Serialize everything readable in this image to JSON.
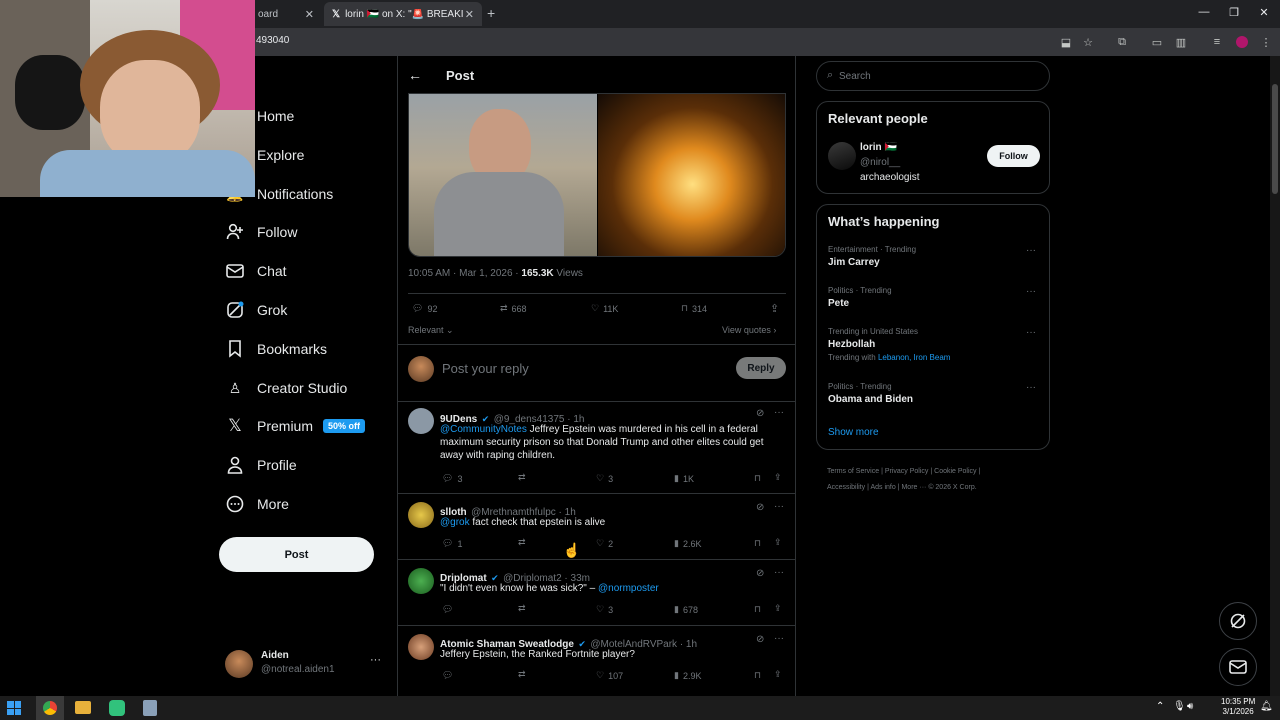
{
  "browser": {
    "tabs": [
      {
        "label": "oard"
      },
      {
        "label": "lorin 🇵🇸 on X: \"🚨 BREAKING: N"
      }
    ],
    "url": "493040"
  },
  "nav": {
    "items": [
      {
        "label": "Home"
      },
      {
        "label": "Explore"
      },
      {
        "label": "Notifications"
      },
      {
        "label": "Follow"
      },
      {
        "label": "Chat"
      },
      {
        "label": "Grok"
      },
      {
        "label": "Bookmarks"
      },
      {
        "label": "Creator Studio"
      },
      {
        "label": "Premium"
      },
      {
        "label": "Profile"
      },
      {
        "label": "More"
      }
    ],
    "premium_badge": "50% off",
    "post_button": "Post",
    "account": {
      "name": "Aiden",
      "handle": "@notreal.aiden1",
      "more": "···"
    }
  },
  "post": {
    "header_title": "Post",
    "timestamp": "10:05 AM · Mar 1, 2026 · ",
    "views_count": "165.3K",
    "views_label": " Views",
    "replies": "92",
    "reposts": "668",
    "likes": "11K",
    "bookmarks": "314",
    "sort": "Relevant",
    "view_quotes": "View quotes",
    "reply_placeholder": "Post your reply",
    "reply_button": "Reply"
  },
  "replies": [
    {
      "name": "9UDens",
      "handle": "@9_dens41375 · 1h",
      "mention": "@CommunityNotes",
      "text": " Jeffrey Epstein was murdered in his cell in a federal maximum security prison so that Donald Trump and other elites could get away with raping children.",
      "replies": "3",
      "reposts": "",
      "likes": "3",
      "views": "1K"
    },
    {
      "name": "slloth",
      "handle": "@Mrethnamthfulpc · 1h",
      "mention": "@grok",
      "text": " fact check that epstein is alive",
      "replies": "1",
      "reposts": "",
      "likes": "2",
      "views": "2.6K"
    },
    {
      "name": "Driplomat",
      "handle": "@Driplomat2 · 33m",
      "text": "\"I didn't even know he was sick?\" – ",
      "mention_after": "@normposter",
      "replies": "",
      "reposts": "",
      "likes": "3",
      "views": "678"
    },
    {
      "name": "Atomic Shaman Sweatlodge",
      "handle": "@MotelAndRVPark · 1h",
      "text": "Jeffery Epstein, the Ranked Fortnite player?",
      "replies": "",
      "reposts": "",
      "likes": "107",
      "views": "2.9K"
    }
  ],
  "sidebar": {
    "search_placeholder": "Search",
    "relevant_title": "Relevant people",
    "person": {
      "name": "lorin 🇵🇸",
      "handle": "@nirol__",
      "bio": "archaeologist",
      "follow": "Follow"
    },
    "happening_title": "What’s happening",
    "trends": [
      {
        "category": "Entertainment · Trending",
        "name": "Jim Carrey"
      },
      {
        "category": "Politics · Trending",
        "name": "Pete"
      },
      {
        "category": "Trending in United States",
        "name": "Hezbollah",
        "extra_prefix": "Trending with ",
        "extra_links": "Lebanon, Iron Beam"
      },
      {
        "category": "Politics · Trending",
        "name": "Obama and Biden"
      }
    ],
    "show_more": "Show more",
    "footer": [
      "Terms of Service",
      "Privacy Policy",
      "Cookie Policy",
      "Accessibility",
      "Ads info",
      "More ···",
      "© 2026 X Corp."
    ]
  },
  "taskbar": {
    "time": "10:35 PM",
    "date": "3/1/2026"
  },
  "colors": {
    "accent": "#1d9bf0",
    "text": "#e7e9ea",
    "muted": "#71767b",
    "border": "#2f3336"
  }
}
